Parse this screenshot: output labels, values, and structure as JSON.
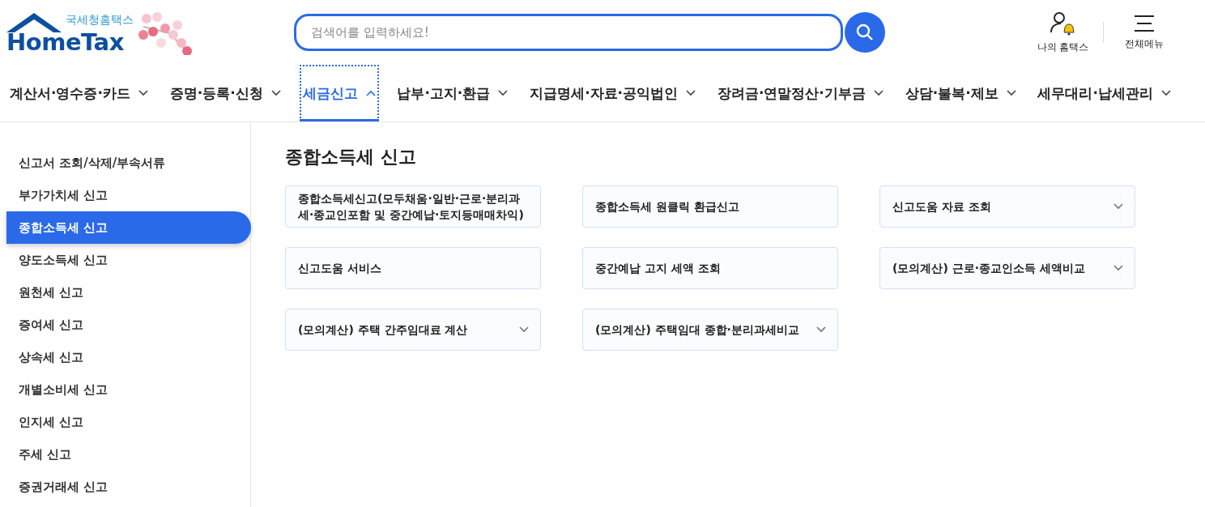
{
  "logo": {
    "subtitle": "국세청홈택스",
    "name": "HomeTax"
  },
  "search": {
    "placeholder": "검색어를 입력하세요!"
  },
  "utility": [
    {
      "kind": "mytax",
      "label": "나의 홈택스"
    },
    {
      "kind": "menu",
      "label": "전체메뉴"
    }
  ],
  "nav": [
    {
      "label": "계산서·영수증·카드",
      "selected": false
    },
    {
      "label": "증명·등록·신청",
      "selected": false
    },
    {
      "label": "세금신고",
      "selected": true
    },
    {
      "label": "납부·고지·환급",
      "selected": false
    },
    {
      "label": "지급명세·자료·공익법인",
      "selected": false
    },
    {
      "label": "장려금·연말정산·기부금",
      "selected": false
    },
    {
      "label": "상담·불복·제보",
      "selected": false
    },
    {
      "label": "세무대리·납세관리",
      "selected": false
    }
  ],
  "sidebar": {
    "items": [
      {
        "label": "신고서 조회/삭제/부속서류",
        "selected": false
      },
      {
        "label": "부가가치세 신고",
        "selected": false
      },
      {
        "label": "종합소득세 신고",
        "selected": true
      },
      {
        "label": "양도소득세 신고",
        "selected": false
      },
      {
        "label": "원천세 신고",
        "selected": false
      },
      {
        "label": "증여세 신고",
        "selected": false
      },
      {
        "label": "상속세 신고",
        "selected": false
      },
      {
        "label": "개별소비세 신고",
        "selected": false
      },
      {
        "label": "인지세 신고",
        "selected": false
      },
      {
        "label": "주세 신고",
        "selected": false
      },
      {
        "label": "증권거래세 신고",
        "selected": false
      }
    ]
  },
  "content": {
    "title": "종합소득세 신고",
    "cards": [
      {
        "label": "종합소득세신고(모두채움·일반·근로·분리과세·종교인포함 및 중간예납·토지등매매차익)",
        "expandable": false
      },
      {
        "label": "종합소득세 원클릭 환급신고",
        "expandable": false
      },
      {
        "label": "신고도움 자료 조회",
        "expandable": true
      },
      {
        "label": "신고도움 서비스",
        "expandable": false
      },
      {
        "label": "중간예납 고지 세액 조회",
        "expandable": false
      },
      {
        "label": "(모의계산) 근로·종교인소득 세액비교",
        "expandable": true
      },
      {
        "label": "(모의계산) 주택 간주임대료 계산",
        "expandable": true
      },
      {
        "label": "(모의계산) 주택임대 종합·분리과세비교",
        "expandable": true
      }
    ]
  }
}
